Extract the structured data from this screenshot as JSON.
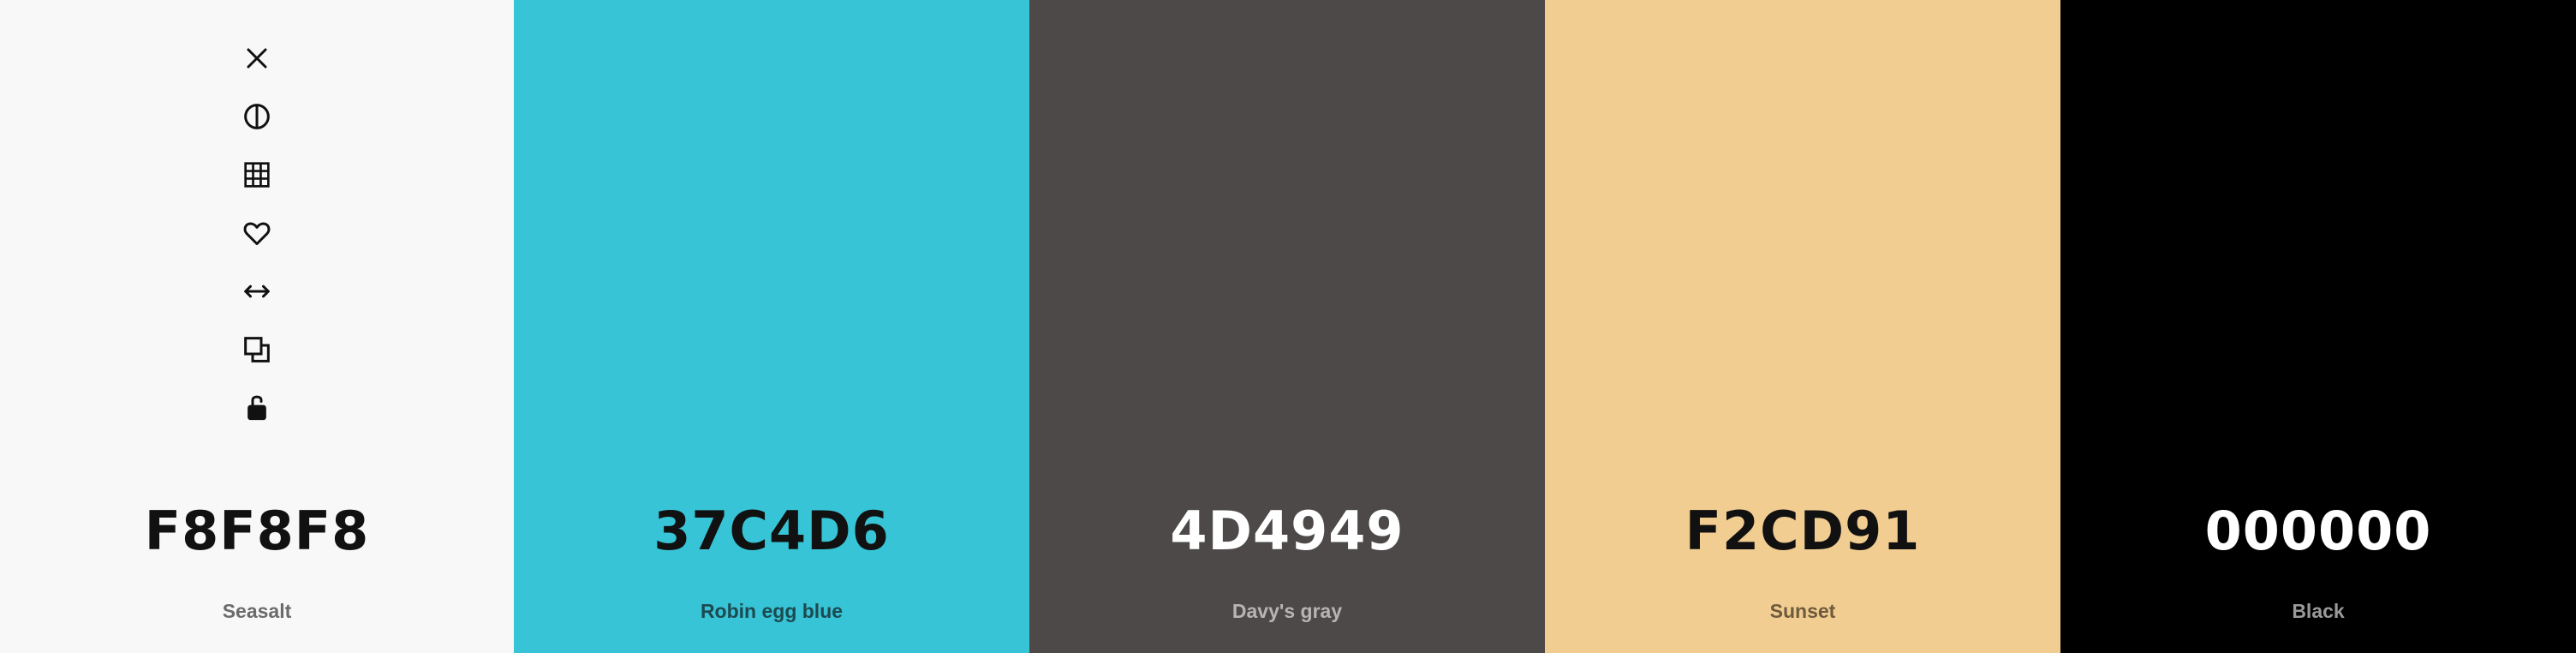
{
  "swatches": [
    {
      "hex": "F8F8F8",
      "name": "Seasalt",
      "bg": "#F8F8F8",
      "hex_color": "#111111",
      "name_color": "#6b6b6b"
    },
    {
      "hex": "37C4D6",
      "name": "Robin egg blue",
      "bg": "#37C4D6",
      "hex_color": "#111111",
      "name_color": "#1c4a50"
    },
    {
      "hex": "4D4949",
      "name": "Davy's gray",
      "bg": "#4D4949",
      "hex_color": "#ffffff",
      "name_color": "#b8b4b4"
    },
    {
      "hex": "F2CD91",
      "name": "Sunset",
      "bg": "#F2CD91",
      "hex_color": "#111111",
      "name_color": "#6e5a3c"
    },
    {
      "hex": "000000",
      "name": "Black",
      "bg": "#000000",
      "hex_color": "#ffffff",
      "name_color": "#9a9a9a"
    }
  ],
  "toolbar": {
    "icons": [
      "close-icon",
      "contrast-icon",
      "shades-grid-icon",
      "heart-icon",
      "drag-arrows-icon",
      "copy-icon",
      "unlock-icon"
    ]
  }
}
